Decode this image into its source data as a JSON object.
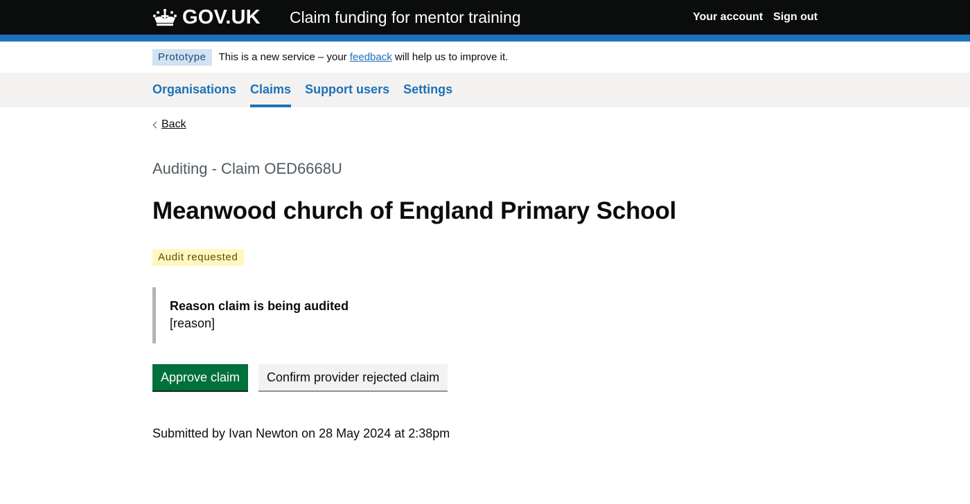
{
  "header": {
    "logo_text": "GOV.UK",
    "service_name": "Claim funding for mentor training",
    "links": [
      "Your account",
      "Sign out"
    ],
    "colors": {
      "background": "#0b0c0c",
      "stripe": "#1d70b8"
    }
  },
  "phase_banner": {
    "tag": "Prototype",
    "text_before": "This is a new service – your ",
    "link": "feedback",
    "text_after": " will help us to improve it."
  },
  "nav": {
    "items": [
      {
        "label": "Organisations",
        "active": false
      },
      {
        "label": "Claims",
        "active": true
      },
      {
        "label": "Support users",
        "active": false
      },
      {
        "label": "Settings",
        "active": false
      }
    ]
  },
  "main": {
    "back_label": "Back",
    "caption": "Auditing - Claim OED6668U",
    "title": "Meanwood church of England Primary School",
    "status": "Audit requested",
    "inset": {
      "heading": "Reason claim is being audited",
      "body": "[reason]"
    },
    "buttons": {
      "primary": "Approve claim",
      "secondary": "Confirm provider rejected claim"
    },
    "submitted": "Submitted by Ivan Newton on 28 May 2024 at 2:38pm"
  }
}
